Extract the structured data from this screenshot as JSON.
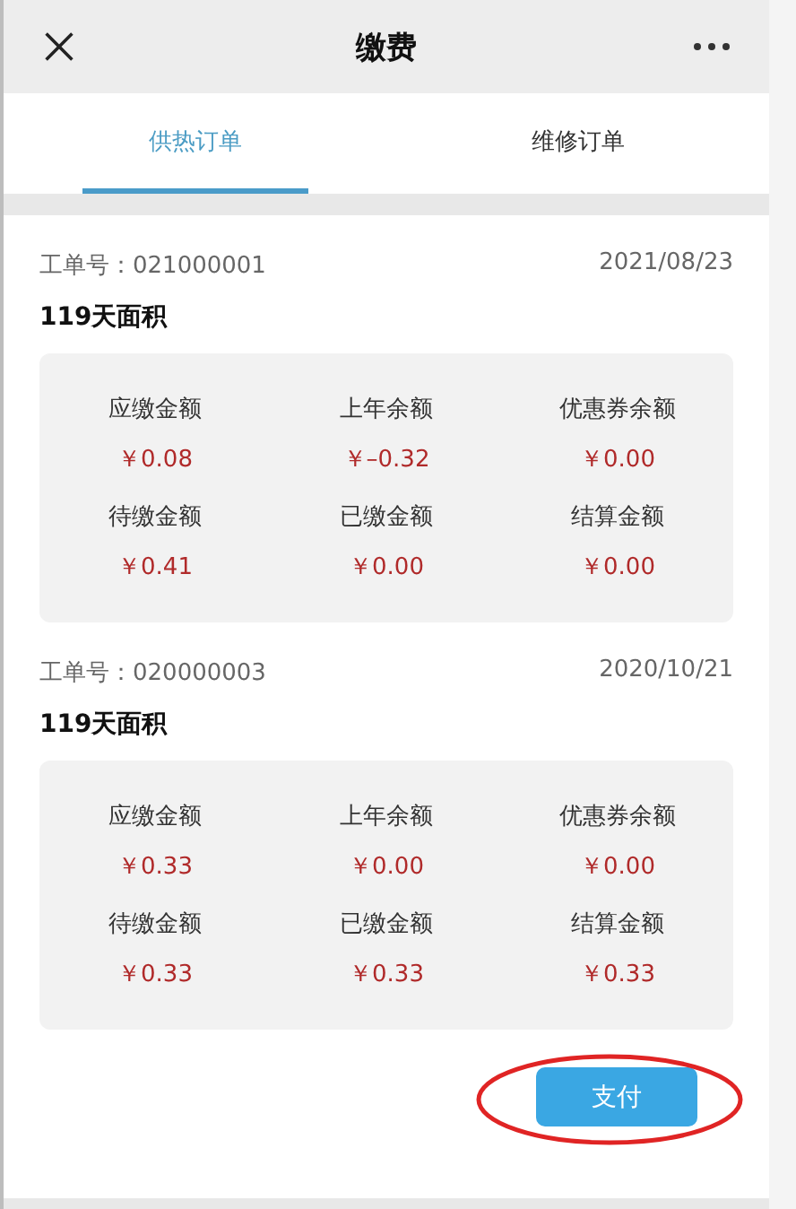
{
  "nav": {
    "title": "缴费"
  },
  "tabs": [
    {
      "label": "供热订单",
      "selected": true
    },
    {
      "label": "维修订单",
      "selected": false
    }
  ],
  "orders": [
    {
      "number_label": "工单号：",
      "number": "021000001",
      "date": "2021/08/23",
      "title": "119天面积",
      "amounts": [
        {
          "label": "应缴金额",
          "value": "￥0.08"
        },
        {
          "label": "上年余额",
          "value": "￥–0.32"
        },
        {
          "label": "优惠券余额",
          "value": "￥0.00"
        },
        {
          "label": "待缴金额",
          "value": "￥0.41"
        },
        {
          "label": "已缴金额",
          "value": "￥0.00"
        },
        {
          "label": "结算金额",
          "value": "￥0.00"
        }
      ]
    },
    {
      "number_label": "工单号：",
      "number": "020000003",
      "date": "2020/10/21",
      "title": "119天面积",
      "amounts": [
        {
          "label": "应缴金额",
          "value": "￥0.33"
        },
        {
          "label": "上年余额",
          "value": "￥0.00"
        },
        {
          "label": "优惠券余额",
          "value": "￥0.00"
        },
        {
          "label": "待缴金额",
          "value": "￥0.33"
        },
        {
          "label": "已缴金额",
          "value": "￥0.33"
        },
        {
          "label": "结算金额",
          "value": "￥0.33"
        }
      ]
    }
  ],
  "pay_button": {
    "label": "支付",
    "highlighted": true
  }
}
